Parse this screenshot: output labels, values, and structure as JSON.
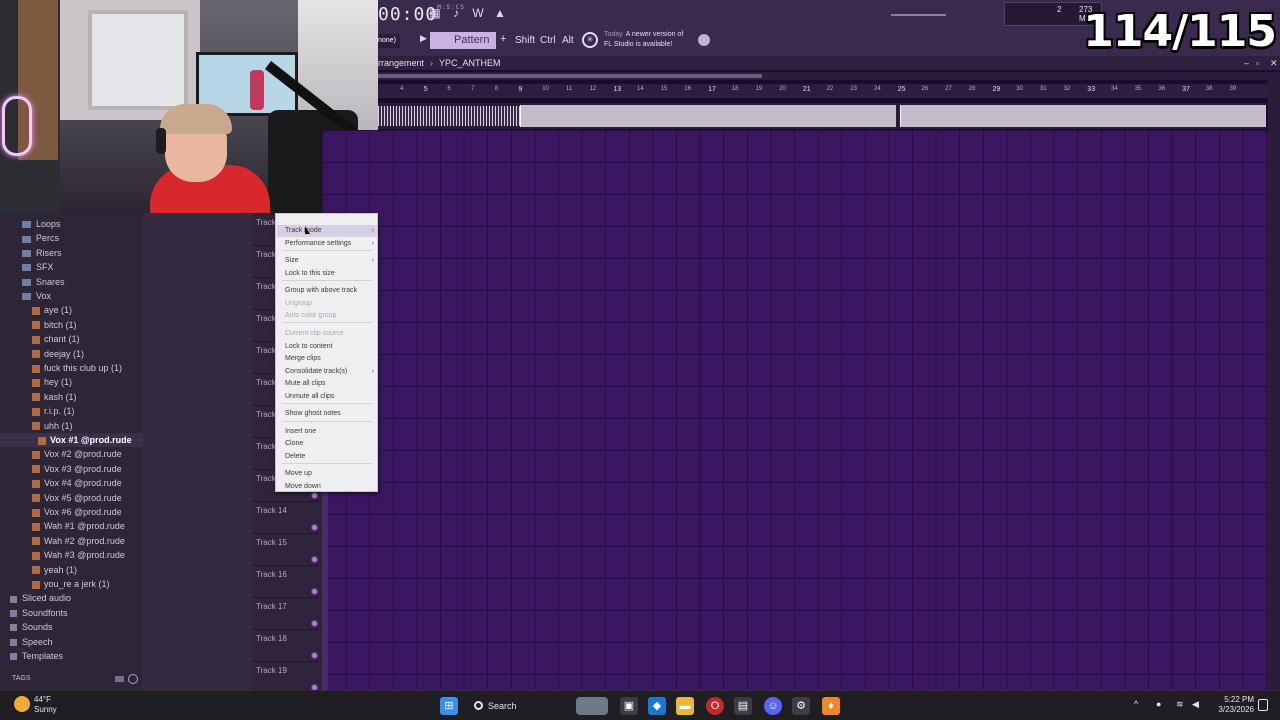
{
  "overlay": {
    "counter": "114/115"
  },
  "toolbar": {
    "time": "00:00",
    "time_unit": "M:S:CS",
    "pattern": "Pattern 1",
    "mode": "none)",
    "keys": [
      "Shift",
      "Ctrl",
      "Alt"
    ],
    "cpu_value": "2",
    "memory": "273 MB",
    "poly": "0",
    "news_prefix": "Today",
    "news_line1": "A newer version of",
    "news_line2": "FL Studio is available!"
  },
  "playlist": {
    "title_prefix": "rrangement",
    "project": "YPC_ANTHEM",
    "ruler": [
      "4",
      "5",
      "6",
      "7",
      "8",
      "9",
      "10",
      "11",
      "12",
      "13",
      "14",
      "15",
      "16",
      "17",
      "18",
      "19",
      "20",
      "21",
      "22",
      "23",
      "24",
      "25",
      "26",
      "27",
      "28",
      "29",
      "30",
      "31",
      "32",
      "33",
      "34",
      "35",
      "36",
      "37",
      "38",
      "39"
    ],
    "tracks": [
      "Track",
      "Track",
      "Track",
      "Track",
      "Track",
      "Track",
      "Track",
      "Track",
      "Track",
      "Track 14",
      "Track 15",
      "Track 16",
      "Track 17",
      "Track 18",
      "Track 19"
    ]
  },
  "browser": {
    "items": [
      {
        "label": "Loops",
        "kind": "folder",
        "indent": 1
      },
      {
        "label": "Percs",
        "kind": "folder",
        "indent": 1
      },
      {
        "label": "Risers",
        "kind": "folder",
        "indent": 1
      },
      {
        "label": "SFX",
        "kind": "folder",
        "indent": 1
      },
      {
        "label": "Snares",
        "kind": "folder",
        "indent": 1
      },
      {
        "label": "Vox",
        "kind": "folder",
        "indent": 1,
        "open": true
      },
      {
        "label": "aye (1)",
        "kind": "file",
        "indent": 2
      },
      {
        "label": "bitch (1)",
        "kind": "file",
        "indent": 2
      },
      {
        "label": "chant (1)",
        "kind": "file",
        "indent": 2
      },
      {
        "label": "deejay (1)",
        "kind": "file",
        "indent": 2
      },
      {
        "label": "fuck this club up (1)",
        "kind": "file",
        "indent": 2
      },
      {
        "label": "hey (1)",
        "kind": "file",
        "indent": 2
      },
      {
        "label": "kash (1)",
        "kind": "file",
        "indent": 2
      },
      {
        "label": "r.i.p. (1)",
        "kind": "file",
        "indent": 2
      },
      {
        "label": "uhh (1)",
        "kind": "file",
        "indent": 2
      },
      {
        "label": "Vox #1 @prod.rude",
        "kind": "file",
        "indent": 3,
        "selected": true
      },
      {
        "label": "Vox #2 @prod.rude",
        "kind": "file",
        "indent": 2
      },
      {
        "label": "Vox #3 @prod.rude",
        "kind": "file",
        "indent": 2
      },
      {
        "label": "Vox #4 @prod.rude",
        "kind": "file",
        "indent": 2
      },
      {
        "label": "Vox #5 @prod.rude",
        "kind": "file",
        "indent": 2
      },
      {
        "label": "Vox #6 @prod.rude",
        "kind": "file",
        "indent": 2
      },
      {
        "label": "Wah #1 @prod.rude",
        "kind": "file",
        "indent": 2
      },
      {
        "label": "Wah #2 @prod.rude",
        "kind": "file",
        "indent": 2
      },
      {
        "label": "Wah #3 @prod.rude",
        "kind": "file",
        "indent": 2
      },
      {
        "label": "yeah (1)",
        "kind": "file",
        "indent": 2
      },
      {
        "label": "you_re a jerk (1)",
        "kind": "file",
        "indent": 2
      },
      {
        "label": "Sliced audio",
        "kind": "root",
        "indent": 0
      },
      {
        "label": "Soundfonts",
        "kind": "root",
        "indent": 0
      },
      {
        "label": "Sounds",
        "kind": "root",
        "indent": 0
      },
      {
        "label": "Speech",
        "kind": "root",
        "indent": 0
      },
      {
        "label": "Templates",
        "kind": "root",
        "indent": 0
      }
    ],
    "tags_label": "TAGS"
  },
  "context_menu": {
    "items": [
      {
        "label": "Track mode",
        "submenu": true,
        "highlighted": true
      },
      {
        "label": "Performance settings",
        "submenu": true
      },
      {
        "label": "Size",
        "submenu": true
      },
      {
        "label": "Lock to this size"
      },
      {
        "label": "Group with above track"
      },
      {
        "label": "Ungroup",
        "disabled": true
      },
      {
        "label": "Auto color group",
        "disabled": true
      },
      {
        "label": "Current clip source",
        "disabled": true
      },
      {
        "label": "Lock to content"
      },
      {
        "label": "Merge clips"
      },
      {
        "label": "Consolidate track(s)",
        "submenu": true
      },
      {
        "label": "Mute all clips"
      },
      {
        "label": "Unmute all clips"
      },
      {
        "label": "Show ghost notes"
      },
      {
        "label": "Insert one"
      },
      {
        "label": "Clone"
      },
      {
        "label": "Delete"
      },
      {
        "label": "Move up"
      },
      {
        "label": "Move down"
      }
    ]
  },
  "taskbar": {
    "temp": "44°F",
    "condition": "Sunny",
    "search_label": "Search",
    "time": "5:22 PM",
    "date": "3/23/2026"
  },
  "colors": {
    "grid": "#3a1760",
    "menu_bg": "#efeef1",
    "clip": "#c4bcca",
    "accent": "#c9b3e3"
  }
}
